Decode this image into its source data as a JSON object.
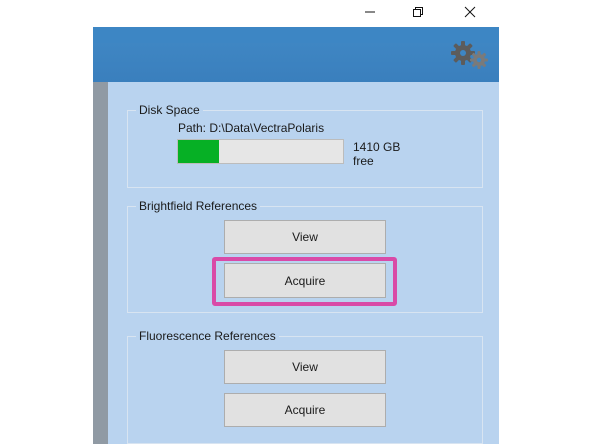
{
  "window": {
    "minimize_icon": "minimize-icon",
    "restore_icon": "restore-icon",
    "close_icon": "close-icon"
  },
  "header": {
    "settings_icon": "gears-icon",
    "color": "#3d86c4"
  },
  "disk_space": {
    "title": "Disk Space",
    "path_label": "Path: D:\\Data\\VectraPolaris",
    "usage_fraction": 0.25,
    "free_amount": "1410 GB",
    "free_suffix": "free",
    "bar_color": "#06b025"
  },
  "brightfield": {
    "title": "Brightfield References",
    "view_label": "View",
    "acquire_label": "Acquire"
  },
  "fluorescence": {
    "title": "Fluorescence References",
    "view_label": "View",
    "acquire_label": "Acquire"
  },
  "highlight_color": "#d94aa7"
}
